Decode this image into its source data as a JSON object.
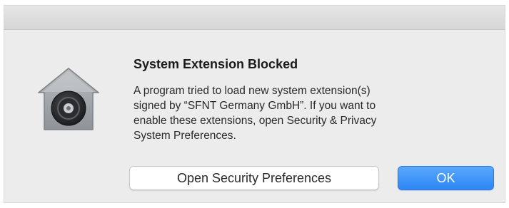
{
  "dialog": {
    "title": "System Extension Blocked",
    "message_lines": [
      "A program tried to load new system extension(s)",
      "signed by “SFNT Germany GmbH”.  If you want to",
      "enable these extensions, open Security & Privacy",
      "System Preferences."
    ],
    "icon": "security-lock-house-icon",
    "buttons": {
      "open_preferences_label": "Open Security Preferences",
      "ok_label": "OK"
    },
    "accent_color": "#2d86f7"
  }
}
